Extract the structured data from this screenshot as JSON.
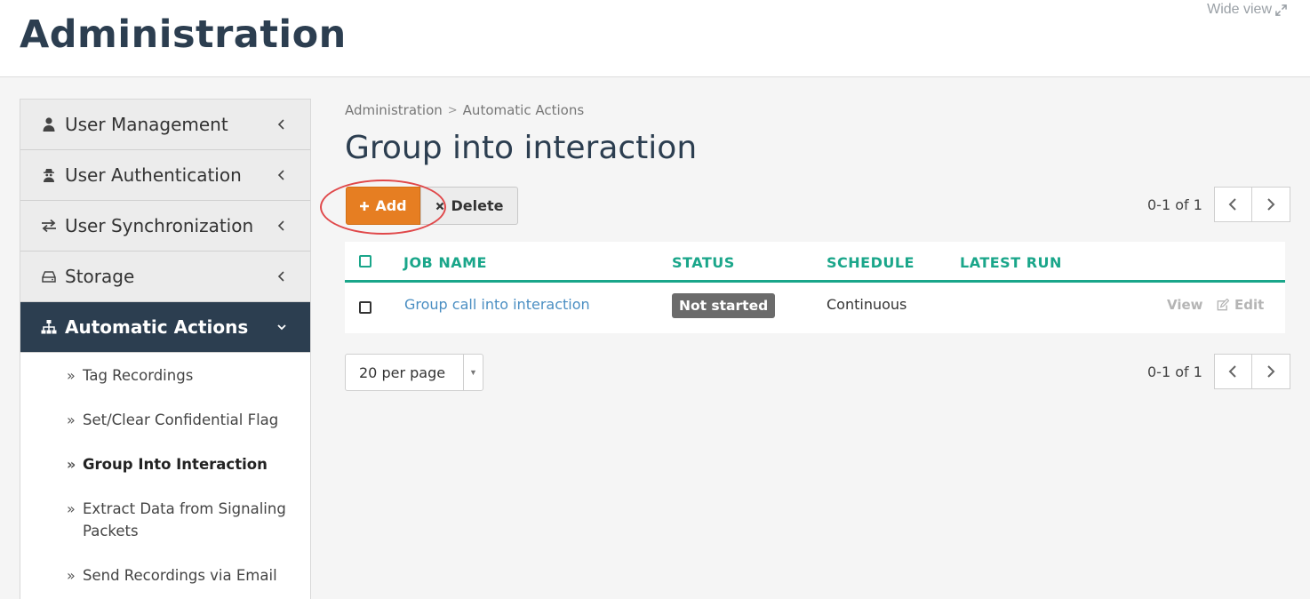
{
  "header": {
    "title": "Administration",
    "wide_view_label": "Wide view"
  },
  "sidebar": {
    "items": [
      {
        "label": "User Management",
        "icon": "user-icon"
      },
      {
        "label": "User Authentication",
        "icon": "user-secret-icon"
      },
      {
        "label": "User Synchronization",
        "icon": "exchange-icon"
      },
      {
        "label": "Storage",
        "icon": "hdd-icon"
      },
      {
        "label": "Automatic Actions",
        "icon": "sitemap-icon",
        "active": true
      }
    ],
    "subitems": [
      {
        "label": "Tag Recordings"
      },
      {
        "label": "Set/Clear Confidential Flag"
      },
      {
        "label": "Group Into Interaction",
        "current": true
      },
      {
        "label": "Extract Data from Signaling Packets"
      },
      {
        "label": "Send Recordings via Email"
      }
    ]
  },
  "breadcrumb": {
    "items": [
      "Administration",
      "Automatic Actions"
    ],
    "separator": ">"
  },
  "main": {
    "title": "Group into interaction",
    "add_label": "Add",
    "delete_label": "Delete",
    "accent_color": "#e67e22",
    "table_accent_color": "#1aa68a"
  },
  "pagination": {
    "range_top": "0-1 of 1",
    "range_bottom": "0-1 of 1"
  },
  "table": {
    "columns": [
      "JOB NAME",
      "STATUS",
      "SCHEDULE",
      "LATEST RUN"
    ],
    "rows": [
      {
        "job_name": "Group call into interaction",
        "status": "Not started",
        "schedule": "Continuous",
        "latest_run": "",
        "view_label": "View",
        "edit_label": "Edit"
      }
    ]
  },
  "per_page": {
    "value": "20 per page"
  }
}
